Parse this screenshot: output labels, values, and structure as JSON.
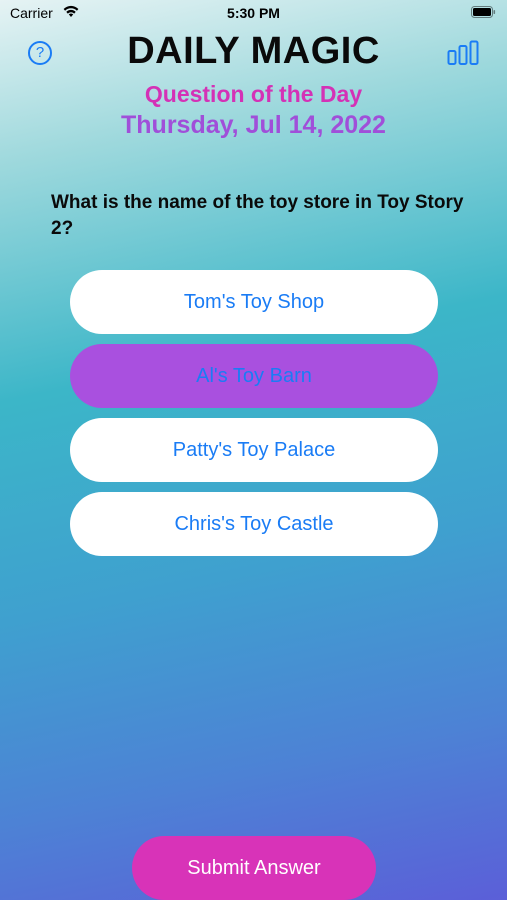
{
  "status_bar": {
    "carrier": "Carrier",
    "time": "5:30 PM"
  },
  "header": {
    "title": "DAILY MAGIC",
    "subtitle": "Question of the Day",
    "date": "Thursday, Jul 14, 2022",
    "help_label": "?"
  },
  "question": {
    "text": "What is the name of the toy store in Toy Story 2?"
  },
  "answers": [
    {
      "label": "Tom's Toy Shop",
      "selected": false
    },
    {
      "label": "Al's Toy Barn",
      "selected": true
    },
    {
      "label": "Patty's Toy Palace",
      "selected": false
    },
    {
      "label": "Chris's Toy Castle",
      "selected": false
    }
  ],
  "submit": {
    "label": "Submit Answer"
  },
  "icons": {
    "help": "question-circle-icon",
    "stats": "bar-chart-icon",
    "wifi": "wifi-icon",
    "battery": "battery-icon"
  },
  "colors": {
    "accent_blue": "#1a7cf5",
    "selected_purple": "#a950df",
    "submit_pink": "#d833b8",
    "subtitle_pink": "#d431b6",
    "date_purple": "#a04fd9"
  }
}
